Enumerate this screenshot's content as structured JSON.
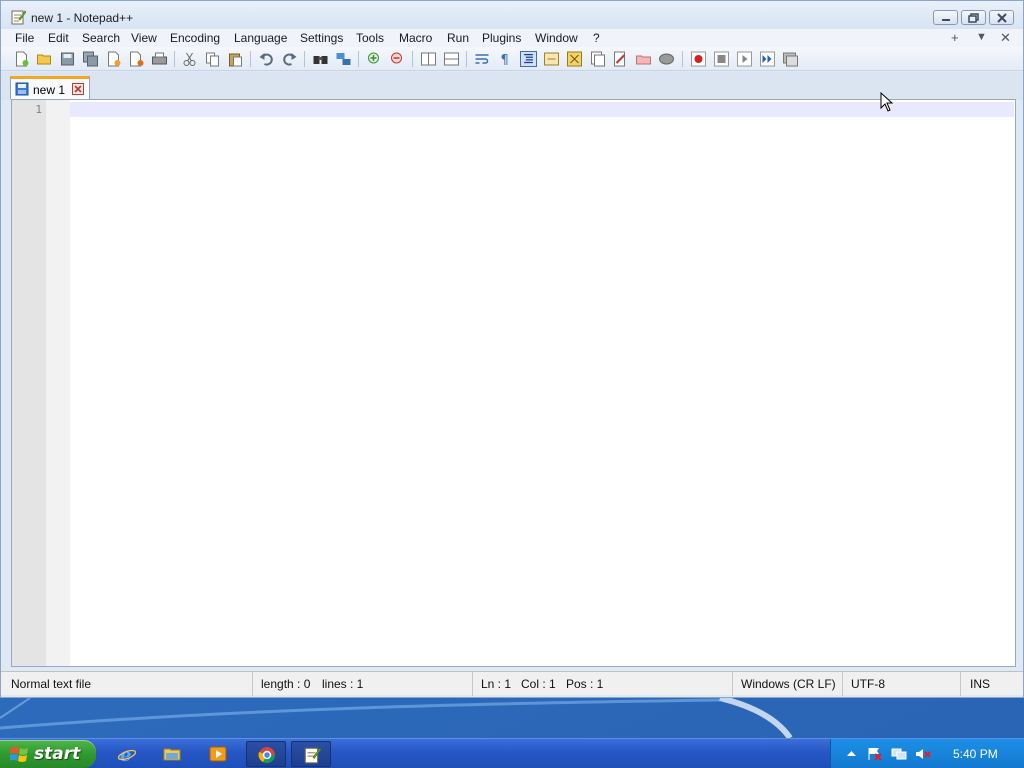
{
  "window": {
    "title": "new 1 - Notepad++",
    "buttons": {
      "minimize": "minimize",
      "maximize": "restore",
      "close": "close"
    }
  },
  "menu": {
    "items": [
      "File",
      "Edit",
      "Search",
      "View",
      "Encoding",
      "Language",
      "Settings",
      "Tools",
      "Macro",
      "Run",
      "Plugins",
      "Window",
      "?"
    ],
    "right": {
      "plus": "+",
      "down": "▼",
      "close": "✕"
    }
  },
  "toolbar": {
    "icons": [
      "new-file-icon",
      "open-file-icon",
      "save-icon",
      "save-all-icon",
      "close-icon",
      "close-all-icon",
      "print-icon",
      "cut-icon",
      "copy-icon",
      "paste-icon",
      "undo-icon",
      "redo-icon",
      "find-icon",
      "replace-icon",
      "zoom-in-icon",
      "zoom-out-icon",
      "sync-vertical-icon",
      "sync-horizontal-icon",
      "word-wrap-icon",
      "show-all-chars-icon",
      "indent-guide-icon",
      "user-defined-language-icon",
      "doc-map-icon",
      "function-list-icon",
      "folder-as-workspace-icon",
      "monitoring-icon",
      "record-macro-icon",
      "stop-record-icon",
      "play-macro-icon",
      "run-macro-multiple-icon",
      "save-macro-icon"
    ]
  },
  "tabs": [
    {
      "label": "new 1",
      "active": true
    }
  ],
  "editor": {
    "line_numbers": [
      "1"
    ],
    "content": ""
  },
  "statusbar": {
    "file_type": "Normal text file",
    "length": "length : 0",
    "lines": "lines : 1",
    "ln": "Ln : 1",
    "col": "Col : 1",
    "pos": "Pos : 1",
    "eol": "Windows (CR LF)",
    "encoding": "UTF-8",
    "mode": "INS"
  },
  "taskbar": {
    "start_label": "start",
    "apps": [
      "internet-explorer-icon",
      "file-explorer-icon",
      "media-player-icon",
      "chrome-icon",
      "notepadpp-icon"
    ],
    "clock": "5:40 PM"
  },
  "colors": {
    "accent_tab": "#f5a623",
    "current_line": "#e8e8ff",
    "taskbar": "#2657c5",
    "start_green": "#2f9a2e"
  }
}
